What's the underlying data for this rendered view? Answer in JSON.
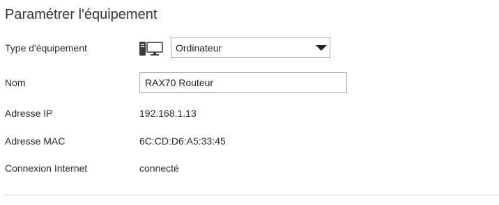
{
  "page": {
    "title": "Paramétrer l'équipement"
  },
  "fields": {
    "device_type": {
      "label": "Type d'équipement",
      "icon": "desktop-computer-icon",
      "selected": "Ordinateur"
    },
    "name": {
      "label": "Nom",
      "value": "RAX70 Routeur"
    },
    "ip": {
      "label": "Adresse IP",
      "value": "192.168.1.13"
    },
    "mac": {
      "label": "Adresse MAC",
      "value": "6C:CD:D6:A5:33:45"
    },
    "connection": {
      "label": "Connexion Internet",
      "value": "connecté"
    }
  }
}
